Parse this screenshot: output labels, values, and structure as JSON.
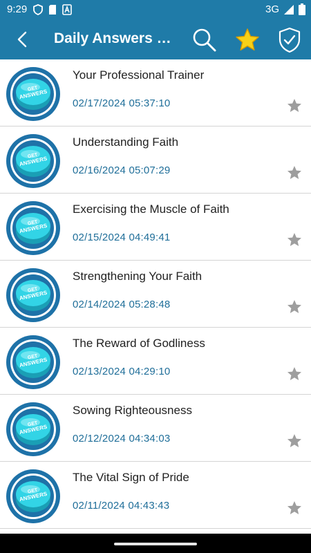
{
  "status": {
    "time": "9:29",
    "network": "3G"
  },
  "appbar": {
    "title": "Daily Answers D...",
    "back_icon": "back-arrow-icon",
    "search_icon": "search-icon",
    "favorites_icon": "star-icon",
    "shield_icon": "shield-check-icon"
  },
  "colors": {
    "primary": "#1f7ba8",
    "date_text": "#1f6e99",
    "star_gray": "#9e9e9e",
    "star_gold": "#f5c518"
  },
  "list": {
    "items": [
      {
        "title": "Your Professional Trainer",
        "date": "02/17/2024 05:37:10"
      },
      {
        "title": "Understanding Faith",
        "date": "02/16/2024 05:07:29"
      },
      {
        "title": "Exercising the Muscle of Faith",
        "date": "02/15/2024 04:49:41"
      },
      {
        "title": "Strengthening Your Faith",
        "date": "02/14/2024 05:28:48"
      },
      {
        "title": "The Reward of Godliness",
        "date": "02/13/2024 04:29:10"
      },
      {
        "title": "Sowing Righteousness",
        "date": "02/12/2024 04:34:03"
      },
      {
        "title": "The Vital Sign of Pride",
        "date": "02/11/2024 04:43:43"
      }
    ],
    "thumbnail_label": "GET ANSWERS"
  }
}
